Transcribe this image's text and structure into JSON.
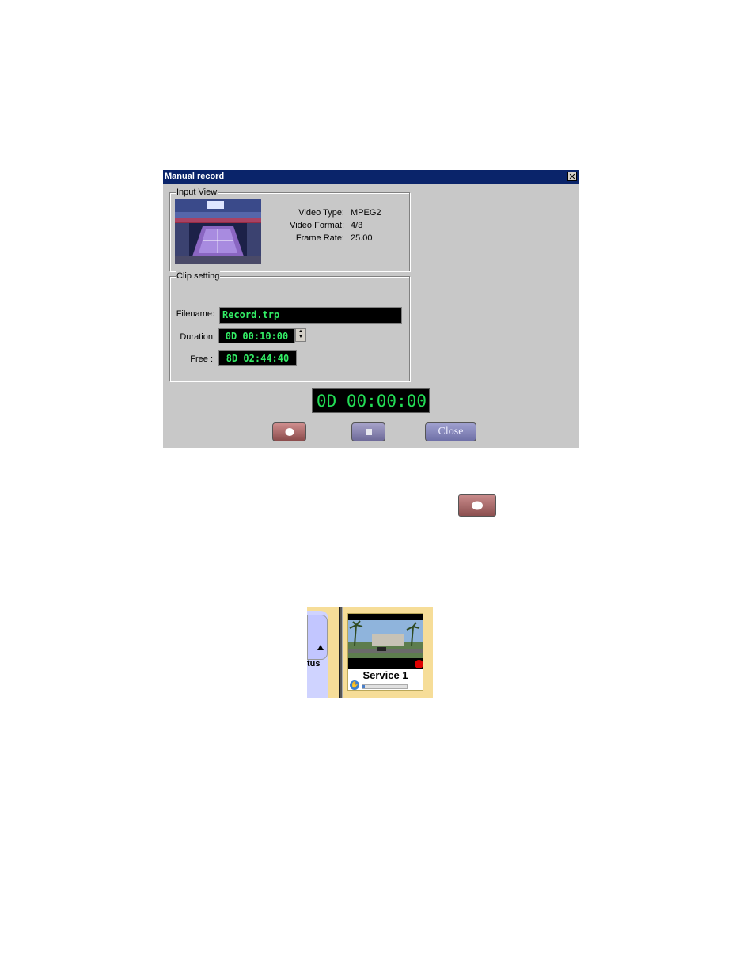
{
  "dialog": {
    "title": "Manual record",
    "close_glyph": "✕",
    "input_view": {
      "label": "Input View",
      "video_type_label": "Video Type:",
      "video_type_value": "MPEG2",
      "video_format_label": "Video Format:",
      "video_format_value": "4/3",
      "frame_rate_label": "Frame Rate:",
      "frame_rate_value": "25.00"
    },
    "clip_setting": {
      "label": "Clip setting",
      "filename_label": "Filename:",
      "filename_value": "Record.trp",
      "duration_label": "Duration:",
      "duration_value": "0D 00:10:00",
      "free_label": "Free :",
      "free_value": "8D 02:44:40"
    },
    "elapsed": "0D 00:00:00",
    "close_label": "Close"
  },
  "service_panel": {
    "tab_fragment": "tus",
    "service_name": "Service 1",
    "progress_fraction": 0.05
  },
  "colors": {
    "title_bar": "#0a246a",
    "lcd_text": "#33ee66",
    "record_button": "#a86464",
    "panel_bg": "#f6dd98"
  },
  "icons": {
    "record": "record-dot-icon",
    "stop": "stop-square-icon",
    "recording_indicator": "red-dot-icon",
    "hand": "hand-icon"
  }
}
